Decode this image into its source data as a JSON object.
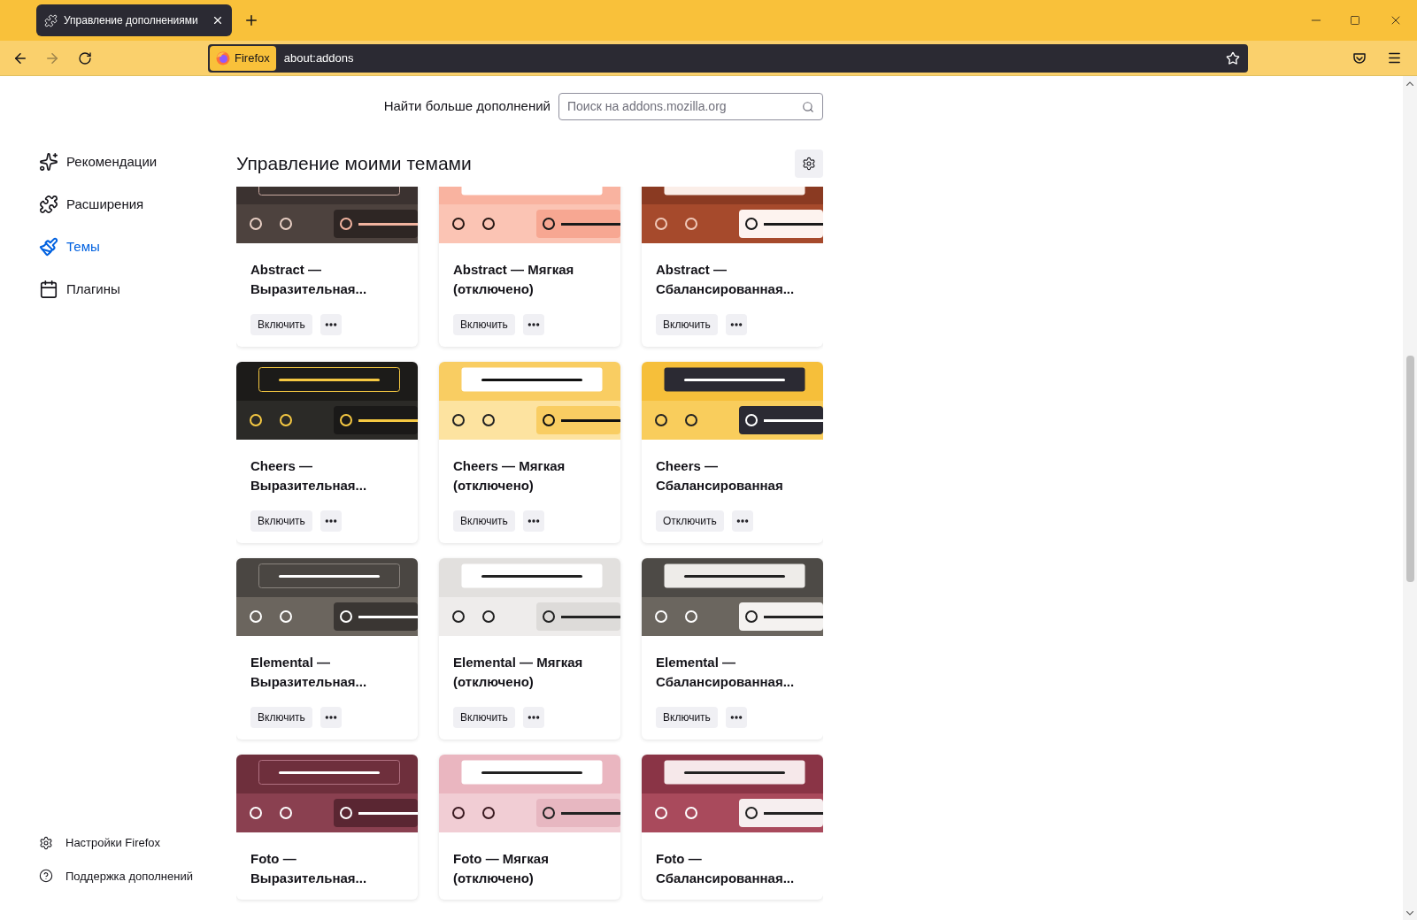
{
  "tabs": [
    {
      "title": "Управление дополнениями",
      "selected": true
    }
  ],
  "toolbar": {
    "back_disabled": false,
    "forward_disabled": true,
    "identity": "Firefox",
    "address": "about:addons"
  },
  "sidebar": {
    "items": [
      {
        "label": "Рекомендации",
        "kind": "recommendations",
        "selected": false
      },
      {
        "label": "Расширения",
        "kind": "extensions",
        "selected": false
      },
      {
        "label": "Темы",
        "kind": "themes",
        "selected": true
      },
      {
        "label": "Плагины",
        "kind": "plugins",
        "selected": false
      }
    ],
    "footer": [
      {
        "label": "Настройки Firefox",
        "kind": "settings"
      },
      {
        "label": "Поддержка дополнений",
        "kind": "help"
      }
    ]
  },
  "search": {
    "label": "Найти больше дополнений",
    "placeholder": "Поиск на addons.mozilla.org"
  },
  "heading": "Управление моими темами",
  "themes": [
    {
      "name": "Abstract — Выразительная...",
      "button": "Включить",
      "preview": {
        "top": {
          "color": "#3b3230"
        },
        "bottom": {
          "color": "#4d423e"
        },
        "bar_border": {
          "color": "#c8a9a0"
        },
        "dot": {
          "color": "#e8cfc4"
        },
        "field": {
          "color": "#2e2624"
        },
        "field_line": {
          "color": "#f2b4a0"
        }
      }
    },
    {
      "name": "Abstract — Мягкая (отключено)",
      "button": "Включить",
      "preview": {
        "top": {
          "color": "#f9b3a0"
        },
        "bottom": {
          "color": "#fbc4b4"
        },
        "bar": {
          "color": "#ffffff"
        },
        "dot": {
          "color": "#2a1a16"
        },
        "field": {
          "color": "#f7a792"
        },
        "field_line": {
          "color": "#1a1a1a"
        }
      }
    },
    {
      "name": "Abstract — Сбалансированная...",
      "button": "Включить",
      "preview": {
        "top": {
          "color": "#8a3a22"
        },
        "bottom": {
          "color": "#a64a2c"
        },
        "bar": {
          "color": "#fbeee8"
        },
        "dot": {
          "color": "#f0c8b8"
        },
        "field": {
          "color": "#fdf3ef"
        },
        "field_line": {
          "color": "#1a1a1a"
        }
      }
    },
    {
      "name": "Cheers — Выразительная...",
      "button": "Включить",
      "preview": {
        "top": {
          "color": "#1c1b19"
        },
        "bottom": {
          "color": "#2b2a27"
        },
        "bar_border": {
          "color": "#f5c842"
        },
        "bar_line": {
          "color": "#f5c842"
        },
        "dot": {
          "color": "#f5c842"
        },
        "field": {
          "color": "#1a1918"
        },
        "field_line": {
          "color": "#f5c842"
        }
      }
    },
    {
      "name": "Cheers — Мягкая (отключено)",
      "button": "Включить",
      "preview": {
        "top": {
          "color": "#f9cd62"
        },
        "bottom": {
          "color": "#fde3a0"
        },
        "bar": {
          "color": "#ffffff"
        },
        "bar_line": {
          "color": "#111111"
        },
        "dot": {
          "color": "#222222"
        },
        "field": {
          "color": "#f9cd62"
        },
        "field_line": {
          "color": "#111111"
        }
      }
    },
    {
      "name": "Cheers — Сбалансированная",
      "button": "Отключить",
      "preview": {
        "top": {
          "color": "#f6bf3a"
        },
        "bottom": {
          "color": "#f9cd5c"
        },
        "bar": {
          "color": "#2b2a33"
        },
        "bar_line": {
          "color": "#ffffff"
        },
        "dot": {
          "color": "#222222"
        },
        "field": {
          "color": "#2b2a33"
        },
        "field_line": {
          "color": "#ffffff"
        }
      }
    },
    {
      "name": "Elemental — Выразительная...",
      "button": "Включить",
      "preview": {
        "top": {
          "color": "#4a4642"
        },
        "bottom": {
          "color": "#6b655e"
        },
        "bar_border": {
          "color": "#8a847e"
        },
        "bar_line": {
          "color": "#ffffff"
        },
        "dot": {
          "color": "#ffffff"
        },
        "field": {
          "color": "#3a3633"
        },
        "field_line": {
          "color": "#ffffff"
        }
      }
    },
    {
      "name": "Elemental — Мягкая (отключено)",
      "button": "Включить",
      "preview": {
        "top": {
          "color": "#e2e0de"
        },
        "bottom": {
          "color": "#eeeceb"
        },
        "bar": {
          "color": "#ffffff"
        },
        "bar_line": {
          "color": "#222222"
        },
        "dot": {
          "color": "#222222"
        },
        "field": {
          "color": "#dddbd9"
        },
        "field_line": {
          "color": "#222222"
        }
      }
    },
    {
      "name": "Elemental — Сбалансированная...",
      "button": "Включить",
      "preview": {
        "top": {
          "color": "#4d4a46"
        },
        "bottom": {
          "color": "#6b665f"
        },
        "bar": {
          "color": "#eeece9"
        },
        "bar_line": {
          "color": "#222222"
        },
        "dot": {
          "color": "#ffffff"
        },
        "field": {
          "color": "#f4f2f0"
        },
        "field_line": {
          "color": "#222222"
        }
      }
    },
    {
      "name": "Foto — Выразительная...",
      "preview": {
        "top": {
          "color": "#6e2f3c"
        },
        "bottom": {
          "color": "#8a4050"
        },
        "bar_border": {
          "color": "#b07080"
        },
        "bar_line": {
          "color": "#ffffff"
        },
        "dot": {
          "color": "#ffffff"
        },
        "field": {
          "color": "#5a2632"
        },
        "field_line": {
          "color": "#ffffff"
        }
      }
    },
    {
      "name": "Foto — Мягкая (отключено)",
      "preview": {
        "top": {
          "color": "#eab6c0"
        },
        "bottom": {
          "color": "#f1cdd4"
        },
        "bar": {
          "color": "#ffffff"
        },
        "bar_line": {
          "color": "#222222"
        },
        "dot": {
          "color": "#3a1a20"
        },
        "field": {
          "color": "#e7b7c1"
        },
        "field_line": {
          "color": "#222222"
        }
      }
    },
    {
      "name": "Foto — Сбалансированная...",
      "preview": {
        "top": {
          "color": "#8a3446"
        },
        "bottom": {
          "color": "#a94a5c"
        },
        "bar": {
          "color": "#f6e8ea"
        },
        "bar_line": {
          "color": "#222222"
        },
        "dot": {
          "color": "#ffffff"
        },
        "field": {
          "color": "#f6eeef"
        },
        "field_line": {
          "color": "#222222"
        }
      }
    }
  ]
}
